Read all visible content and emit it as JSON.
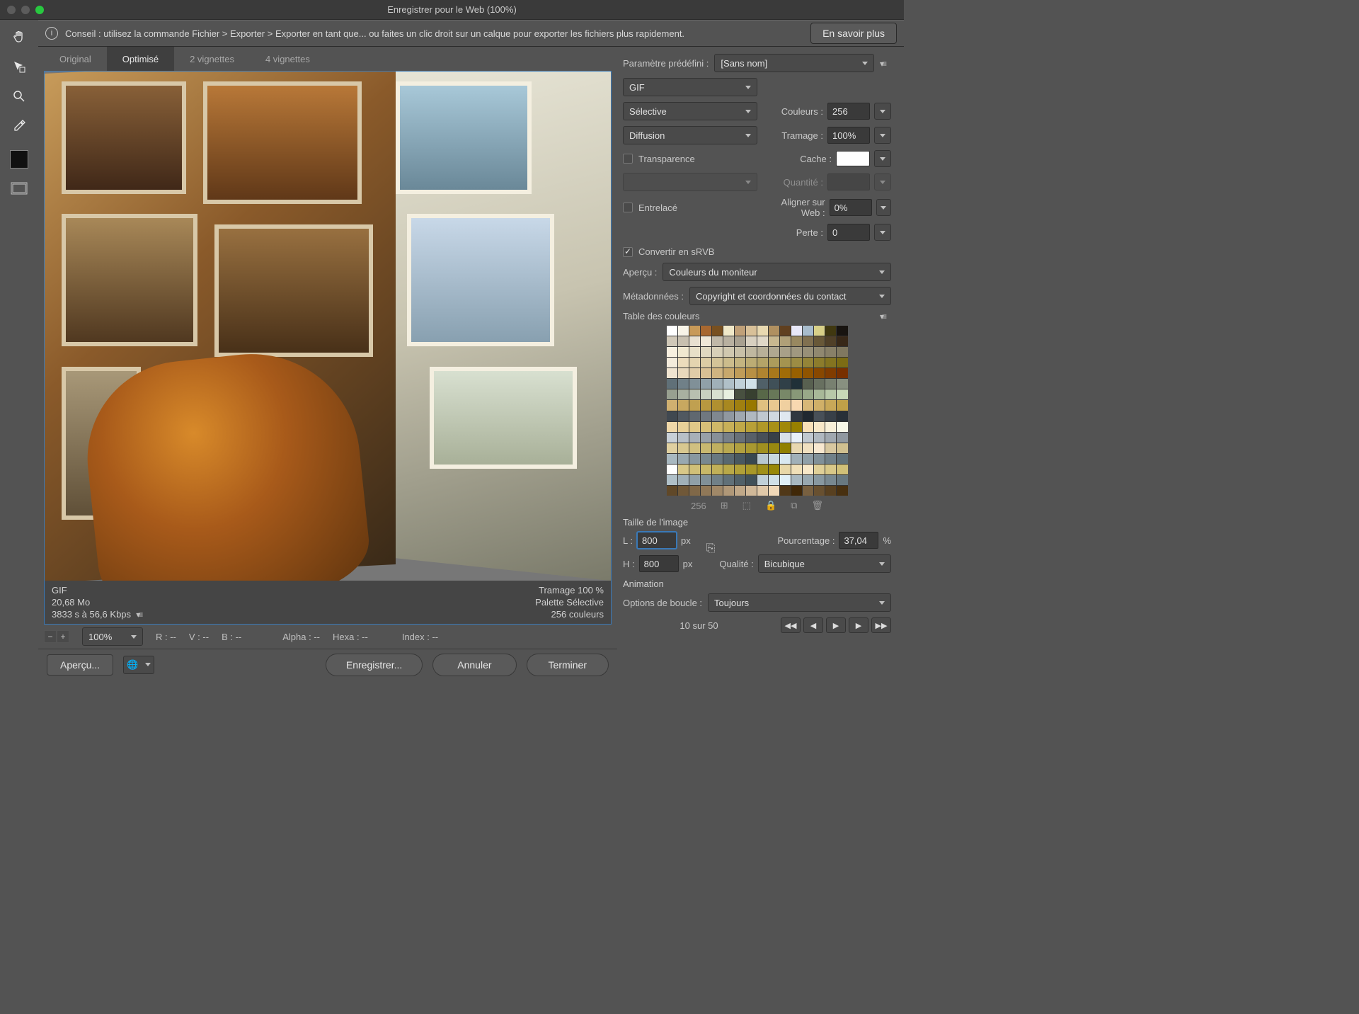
{
  "window": {
    "title": "Enregistrer pour le Web (100%)"
  },
  "infobar": {
    "tip": "Conseil : utilisez la commande Fichier > Exporter > Exporter en tant que... ou faites un clic droit sur un calque pour exporter les fichiers plus rapidement.",
    "learn_more": "En savoir plus"
  },
  "tabs": {
    "original": "Original",
    "optimized": "Optimisé",
    "two_up": "2 vignettes",
    "four_up": "4 vignettes"
  },
  "preview_meta": {
    "format": "GIF",
    "size": "20,68 Mo",
    "time": "3833 s à 56,6 Kbps",
    "dither": "Tramage 100 %",
    "palette": "Palette Sélective",
    "colors": "256 couleurs"
  },
  "status": {
    "zoom": "100%",
    "r": "R : --",
    "v": "V : --",
    "b": "B : --",
    "alpha": "Alpha : --",
    "hexa": "Hexa : --",
    "index": "Index : --"
  },
  "footer": {
    "preview": "Aperçu...",
    "save": "Enregistrer...",
    "cancel": "Annuler",
    "done": "Terminer"
  },
  "settings": {
    "preset_label": "Paramètre prédéfini :",
    "preset_value": "[Sans nom]",
    "format": "GIF",
    "reduction": "Sélective",
    "dither_algo": "Diffusion",
    "colors_label": "Couleurs :",
    "colors_value": "256",
    "dither_label": "Tramage :",
    "dither_value": "100%",
    "transparency": "Transparence",
    "matte_label": "Cache :",
    "amount_label": "Quantité :",
    "interlaced": "Entrelacé",
    "websnap_label": "Aligner sur Web :",
    "websnap_value": "0%",
    "lossy_label": "Perte :",
    "lossy_value": "0",
    "convert_srgb": "Convertir en sRVB",
    "preview_label": "Aperçu :",
    "preview_value": "Couleurs du moniteur",
    "metadata_label": "Métadonnées :",
    "metadata_value": "Copyright et coordonnées du contact"
  },
  "color_table": {
    "title": "Table des couleurs",
    "count": "256"
  },
  "image_size": {
    "title": "Taille de l'image",
    "w_label": "L :",
    "w_value": "800",
    "h_label": "H :",
    "h_value": "800",
    "px": "px",
    "percent_label": "Pourcentage :",
    "percent_value": "37,04",
    "percent_sign": "%",
    "quality_label": "Qualité :",
    "quality_value": "Bicubique"
  },
  "animation": {
    "title": "Animation",
    "loop_label": "Options de boucle :",
    "loop_value": "Toujours",
    "frame": "10 sur 50"
  },
  "color_table_palette": [
    "#ffffff",
    "#f8f4e8",
    "#c89a58",
    "#a86830",
    "#785020",
    "#f0e8c8",
    "#c0a078",
    "#d8c098",
    "#e8d8b0",
    "#b09060",
    "#604020",
    "#e8e8f8",
    "#a8bccc",
    "#d8d088",
    "#403810",
    "#181410",
    "#d0c8b8",
    "#c8c0b0",
    "#e8e0d0",
    "#f0e8d8",
    "#c0b8a8",
    "#b8b0a0",
    "#a8a090",
    "#d8d0c0",
    "#e0d8c8",
    "#c8b890",
    "#b0a078",
    "#988860",
    "#807050",
    "#685838",
    "#504028",
    "#382818",
    "#f8f0e0",
    "#f0e8d0",
    "#e8e0c8",
    "#e0d8c0",
    "#d8d0b8",
    "#d0c8b0",
    "#c8c0a8",
    "#c0b8a0",
    "#b8b098",
    "#b0a890",
    "#a8a088",
    "#a09880",
    "#989078",
    "#908870",
    "#888068",
    "#807860",
    "#f4ecdc",
    "#ecdcbc",
    "#e4d4b0",
    "#dccca4",
    "#d4c498",
    "#ccbc8c",
    "#c4b480",
    "#bcac74",
    "#b4a468",
    "#ac9c5c",
    "#a49450",
    "#9c8c44",
    "#948438",
    "#8c7c2c",
    "#847420",
    "#7c6c14",
    "#f0e4d0",
    "#e8d8bc",
    "#e0cca8",
    "#d8c094",
    "#d0b480",
    "#c8a86c",
    "#c09c58",
    "#b89044",
    "#b08430",
    "#a8781c",
    "#a06c08",
    "#986000",
    "#905400",
    "#884800",
    "#803c00",
    "#783000",
    "#607078",
    "#708088",
    "#809098",
    "#90a0a8",
    "#a0b0b8",
    "#b0c0c8",
    "#c0d0d8",
    "#d0e0e8",
    "#506068",
    "#405058",
    "#304048",
    "#203038",
    "#586050",
    "#687060",
    "#788070",
    "#889080",
    "#98a090",
    "#a8b0a0",
    "#b8c0b0",
    "#c8d0c0",
    "#d8e0d0",
    "#e8f0e0",
    "#485040",
    "#384030",
    "#586848",
    "#687858",
    "#788868",
    "#889878",
    "#98a888",
    "#a8b898",
    "#b8c8a8",
    "#c8d8b8",
    "#d0b070",
    "#c8a860",
    "#c0a050",
    "#b89840",
    "#b09030",
    "#a88820",
    "#a08010",
    "#987800",
    "#e0c080",
    "#e8c890",
    "#f0d0a0",
    "#f8d8b0",
    "#d8b878",
    "#d0b068",
    "#c8a858",
    "#c0a048",
    "#404850",
    "#505860",
    "#606870",
    "#707880",
    "#808890",
    "#9098a0",
    "#a0a8b0",
    "#b0b8c0",
    "#c0c8d0",
    "#d0d8e0",
    "#e0e8f0",
    "#303840",
    "#202830",
    "#485058",
    "#384048",
    "#283038",
    "#f0d8a8",
    "#e8d098",
    "#e0c888",
    "#d8c078",
    "#d0b868",
    "#c8b058",
    "#c0a848",
    "#b8a038",
    "#b09828",
    "#a89018",
    "#a08808",
    "#988000",
    "#f8e0b8",
    "#f8e8c8",
    "#f8f0d8",
    "#f8f8e8",
    "#c8d0d8",
    "#b8c0c8",
    "#a8b0b8",
    "#98a0a8",
    "#889098",
    "#788088",
    "#687078",
    "#586068",
    "#485058",
    "#384048",
    "#d8e0e8",
    "#e8f0f8",
    "#c0c8d0",
    "#b0b8c0",
    "#a0a8b0",
    "#9098a0",
    "#e0d0a0",
    "#d8c890",
    "#d0c080",
    "#c8b870",
    "#c0b060",
    "#b8a850",
    "#b0a040",
    "#a89830",
    "#a09020",
    "#988810",
    "#908000",
    "#e8d8b0",
    "#f0e0c0",
    "#f8e8d0",
    "#d8c8a0",
    "#d0c090",
    "#a8b8c0",
    "#98a8b0",
    "#8898a0",
    "#788890",
    "#687880",
    "#586870",
    "#485860",
    "#384850",
    "#b8c8d0",
    "#c8d8e0",
    "#d8e8f0",
    "#a0b0b8",
    "#90a0a8",
    "#809098",
    "#708088",
    "#607078",
    "#ffffff",
    "#d8c888",
    "#d0c078",
    "#c8b868",
    "#c0b058",
    "#b8a848",
    "#b0a038",
    "#a89828",
    "#a09018",
    "#988808",
    "#e8d8a8",
    "#f0e0b8",
    "#f8e8c8",
    "#e0d098",
    "#d8c888",
    "#d0c078",
    "#b0c0c8",
    "#a0b0b8",
    "#90a0a8",
    "#809098",
    "#708088",
    "#607078",
    "#506068",
    "#405058",
    "#c0d0d8",
    "#d0e0e8",
    "#e0f0f8",
    "#a8b8c0",
    "#98a8b0",
    "#8898a0",
    "#788890",
    "#687880",
    "#604828",
    "#705838",
    "#806848",
    "#907858",
    "#a08868",
    "#b09878",
    "#c0a888",
    "#d0b898",
    "#e0c8a8",
    "#f0d8b8",
    "#503818",
    "#402808",
    "#786040",
    "#685030",
    "#584020",
    "#483010"
  ]
}
